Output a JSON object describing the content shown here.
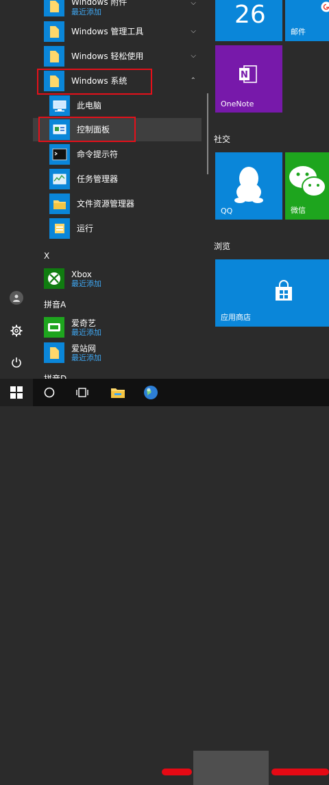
{
  "app_list": {
    "items": [
      {
        "label": "Windows 附件",
        "sub": "最近添加"
      },
      {
        "label": "Windows 管理工具"
      },
      {
        "label": "Windows 轻松使用"
      },
      {
        "label": "Windows 系统"
      },
      {
        "label": "此电脑"
      },
      {
        "label": "控制面板"
      },
      {
        "label": "命令提示符"
      },
      {
        "label": "任务管理器"
      },
      {
        "label": "文件资源管理器"
      },
      {
        "label": "运行"
      },
      {
        "label": "Xbox",
        "sub": "最近添加"
      },
      {
        "label": "爱奇艺",
        "sub": "最近添加"
      },
      {
        "label": "爱站网",
        "sub": "最近添加"
      }
    ],
    "groups": {
      "x": "X",
      "pinyin_a": "拼音A",
      "pinyin_d": "拼音D"
    }
  },
  "tiles": {
    "calendar_day": "26",
    "mail": "邮件",
    "onenote": "OneNote",
    "social": "社交",
    "qq": "QQ",
    "wechat": "微信",
    "browse": "浏览",
    "store": "应用商店"
  },
  "colors": {
    "tile_blue": "#0a86d9",
    "onenote_purple": "#7719aa",
    "wechat_green": "#1ea51e",
    "highlight_red": "#e5101a",
    "recent_blue": "#3fa9f5"
  }
}
